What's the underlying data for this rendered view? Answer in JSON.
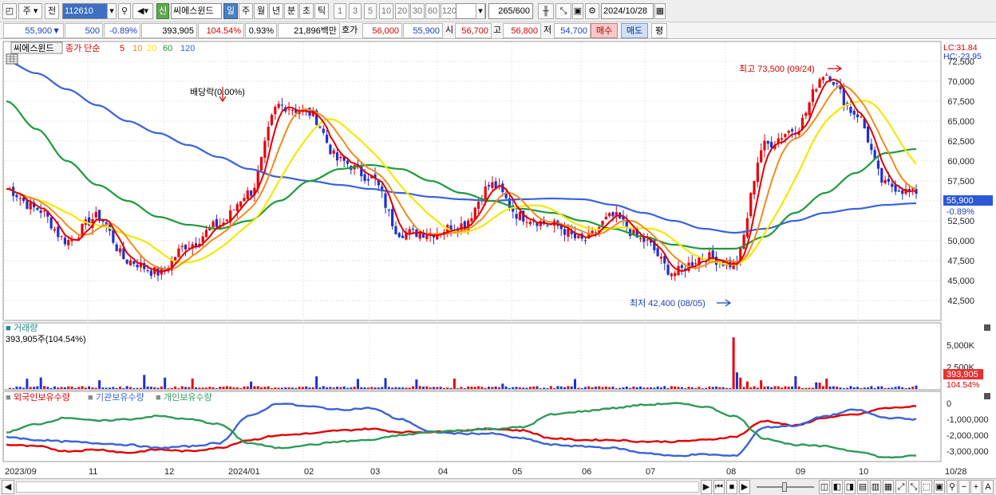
{
  "toolbar": {
    "period_main": "주",
    "prev_label": "전",
    "stock_code": "112610",
    "new_label": "신",
    "stock_name": "씨에스윈드",
    "period_buttons": [
      "일",
      "주",
      "월",
      "년",
      "분",
      "초",
      "틱"
    ],
    "interval_buttons": [
      "1",
      "3",
      "5",
      "10",
      "20",
      "30",
      "60",
      "120"
    ],
    "count_display": "265",
    "count_total": "/600",
    "date": "2024/10/28"
  },
  "quote": {
    "price": "55,900",
    "change_arrow": "▼",
    "change": "500",
    "change_pct": "-0.89%",
    "volume": "393,905",
    "volume_ratio": "104.54%",
    "turnover_pct": "0.93%",
    "amount": "21,896백만",
    "bid_label": "호가",
    "ask_price": "56,000",
    "bid_price": "55,900",
    "open_label": "시",
    "open": "56,700",
    "high_label": "고",
    "high": "56,800",
    "low_label": "저",
    "low": "54,700",
    "buy_label": "매수",
    "sell_label": "매도",
    "avg_label": "평"
  },
  "colors": {
    "up": "#e8000b",
    "down": "#1f2fd0",
    "ma5": "#e00000",
    "ma10": "#f08c1a",
    "ma20": "#f5e800",
    "ma60": "#1f9a3c",
    "ma120": "#3a62d8",
    "foreign": "#e00000",
    "institution": "#3a62d8",
    "individual": "#2f9a58"
  },
  "price_panel": {
    "legend_name": "씨에스윈드",
    "legend_label": "종가 단순",
    "ma_periods": [
      "5",
      "10",
      "20",
      "60",
      "120"
    ],
    "lc_label": "LC:31.84",
    "hc_label": "HC:-23.95",
    "dividend_label": "배당락(0.00%)",
    "high_label": "최고 73,500 (09/24)",
    "low_label": "최저 42,400 (08/05)",
    "current_price_tag": "55,900",
    "current_change_tag": "-0.89%"
  },
  "volume_panel": {
    "title": "거래량",
    "info": "393,905주(104.54%)",
    "current_tag": "393,905",
    "current_pct": "104.54%"
  },
  "holding_panel": {
    "legend": [
      "외국인보유수량",
      "기관보유수량",
      "개인보유수량"
    ]
  },
  "chart_data": [
    {
      "type": "candlestick",
      "title": "씨에스윈드",
      "y_ticks": [
        42500,
        45000,
        47500,
        50000,
        52500,
        55000,
        57500,
        60000,
        62500,
        65000,
        67500,
        70000,
        72500
      ],
      "y_tick_labels": [
        "42,500",
        "45,000",
        "47,500",
        "50,000",
        "52,500",
        "55,000",
        "57,500",
        "60,000",
        "62,500",
        "65,000",
        "67,500",
        "70,000",
        "72,500"
      ],
      "ylim": [
        40200,
        74800
      ],
      "x_labels": [
        "2023/09",
        "11",
        "12",
        "2024/01",
        "02",
        "03",
        "04",
        "05",
        "06",
        "07",
        "08",
        "09",
        "10",
        "10/28"
      ],
      "x": [
        "2023-09-04",
        "2023-09-18",
        "2023-10-04",
        "2023-10-18",
        "2023-11-01",
        "2023-11-15",
        "2023-11-29",
        "2023-12-13",
        "2023-12-27",
        "2024-01-11",
        "2024-01-25",
        "2024-02-08",
        "2024-02-22",
        "2024-03-07",
        "2024-03-21",
        "2024-04-04",
        "2024-04-18",
        "2024-05-02",
        "2024-05-16",
        "2024-05-30",
        "2024-06-13",
        "2024-06-27",
        "2024-07-11",
        "2024-07-25",
        "2024-08-05",
        "2024-08-19",
        "2024-09-02",
        "2024-09-24",
        "2024-10-08",
        "2024-10-21",
        "2024-10-28"
      ],
      "close": [
        56500,
        54000,
        50000,
        53000,
        47500,
        46000,
        49500,
        52000,
        56000,
        67000,
        66000,
        60000,
        58000,
        51000,
        51000,
        52000,
        57000,
        53000,
        52000,
        50000,
        53000,
        50000,
        46000,
        48000,
        47000,
        62000,
        64000,
        71000,
        66000,
        57000,
        55900
      ],
      "ma120": [
        72500,
        71000,
        69000,
        67000,
        65000,
        63500,
        62000,
        60500,
        59000,
        58000,
        57500,
        57000,
        56500,
        56000,
        55500,
        55200,
        55000,
        55200,
        55300,
        55200,
        54500,
        53500,
        52500,
        51500,
        51000,
        51500,
        52500,
        53500,
        54000,
        54500,
        54700
      ],
      "ma60": [
        67500,
        64000,
        60000,
        57000,
        55000,
        53000,
        52000,
        51500,
        52500,
        55000,
        57500,
        59000,
        59500,
        59000,
        57500,
        56000,
        55000,
        54000,
        53500,
        52500,
        51500,
        50500,
        49500,
        49000,
        49000,
        50500,
        53500,
        56000,
        58500,
        61000,
        61500
      ],
      "high_point": {
        "date": "2024-09-24",
        "value": 73500
      },
      "low_point": {
        "date": "2024-08-05",
        "value": 42400
      }
    },
    {
      "type": "bar",
      "title": "거래량",
      "y_tick_labels": [
        "5,000K",
        "2,500K"
      ],
      "y_ticks": [
        5000,
        2500
      ],
      "ylim": [
        0,
        6200
      ],
      "unit": "K",
      "peak_date": "2024-08-05",
      "peak_value": 5900,
      "latest": 393.9
    },
    {
      "type": "line",
      "title": "보유수량",
      "y_ticks": [
        0,
        -1000000,
        -2000000,
        -3000000
      ],
      "y_tick_labels": [
        "0",
        "-1,000,000",
        "-2,000,000",
        "-3,000,000"
      ],
      "ylim": [
        -3600000,
        300000
      ],
      "series": [
        {
          "name": "외국인보유수량",
          "values": [
            -2600000,
            -2700000,
            -3000000,
            -2900000,
            -3100000,
            -2900000,
            -3000000,
            -2800000,
            -2300000,
            -2000000,
            -1900000,
            -1700000,
            -1600000,
            -1800000,
            -1800000,
            -1700000,
            -1600000,
            -1700000,
            -2200000,
            -2300000,
            -2300000,
            -2400000,
            -2400000,
            -2300000,
            -2100000,
            -1100000,
            -1400000,
            -900000,
            -700000,
            -300000,
            -200000
          ]
        },
        {
          "name": "기관보유수량",
          "values": [
            -2100000,
            -2300000,
            -2400000,
            -2500000,
            -2600000,
            -2800000,
            -2700000,
            -2500000,
            -800000,
            0,
            -200000,
            -400000,
            -300000,
            -1000000,
            -1800000,
            -1900000,
            -1900000,
            -2200000,
            -2600000,
            -2700000,
            -2800000,
            -3100000,
            -3300000,
            -3200000,
            -3300000,
            -1500000,
            -1400000,
            -800000,
            -400000,
            -900000,
            -1000000
          ]
        },
        {
          "name": "개인보유수량",
          "values": [
            -1800000,
            -1300000,
            -900000,
            -1100000,
            -1000000,
            -800000,
            -1000000,
            -1300000,
            -2500000,
            -2800000,
            -2600000,
            -2400000,
            -2300000,
            -2000000,
            -1800000,
            -1700000,
            -1600000,
            -1500000,
            -700000,
            -500000,
            -300000,
            -100000,
            0,
            -200000,
            -800000,
            -2200000,
            -2600000,
            -2700000,
            -3000000,
            -3400000,
            -3300000
          ]
        }
      ]
    }
  ]
}
